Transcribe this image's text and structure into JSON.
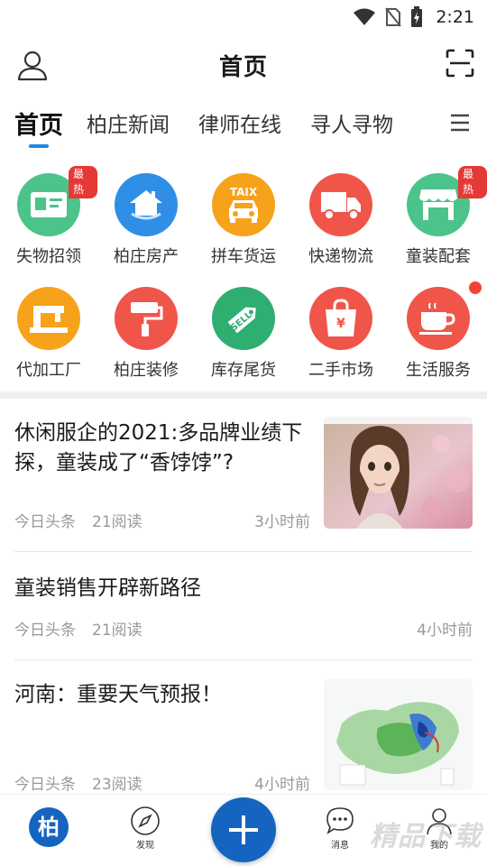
{
  "status": {
    "time": "2:21"
  },
  "header": {
    "title": "首页"
  },
  "tabs": [
    {
      "label": "首页",
      "active": true
    },
    {
      "label": "柏庄新闻"
    },
    {
      "label": "律师在线"
    },
    {
      "label": "寻人寻物"
    }
  ],
  "grid": [
    {
      "label": "失物招领",
      "icon": "id-card-icon",
      "color": "#4cc38a",
      "badge": "最热"
    },
    {
      "label": "柏庄房产",
      "icon": "house-icon",
      "color": "#2f8fe6"
    },
    {
      "label": "拼车货运",
      "icon": "taxi-icon",
      "color": "#f7a21b",
      "icon_text": "TAIX"
    },
    {
      "label": "快递物流",
      "icon": "truck-icon",
      "color": "#f0554a"
    },
    {
      "label": "童装配套",
      "icon": "shop-icon",
      "color": "#4cc38a",
      "badge": "最热"
    },
    {
      "label": "代加工厂",
      "icon": "sewing-machine-icon",
      "color": "#f7a21b"
    },
    {
      "label": "柏庄装修",
      "icon": "paint-roller-icon",
      "color": "#f0554a"
    },
    {
      "label": "库存尾货",
      "icon": "sell-tag-icon",
      "color": "#2fae72",
      "icon_text": "SELL"
    },
    {
      "label": "二手市场",
      "icon": "shopping-bag-icon",
      "color": "#f0554a",
      "icon_text": "¥"
    },
    {
      "label": "生活服务",
      "icon": "coffee-cup-icon",
      "color": "#f0554a",
      "dot": true
    }
  ],
  "news": [
    {
      "headline": "休闲服企的2021:多品牌业绩下探，童装成了“香饽饽”?",
      "source": "今日头条",
      "reads": "21阅读",
      "time": "3小时前",
      "thumb": "doll-photo"
    },
    {
      "headline": "童装销售开辟新路径",
      "source": "今日头条",
      "reads": "21阅读",
      "time": "4小时前"
    },
    {
      "headline": "河南：重要天气预报！",
      "source": "今日头条",
      "reads": "23阅读",
      "time": "4小时前",
      "thumb": "weather-map"
    }
  ],
  "bottom_nav": {
    "logo_text": "柏",
    "discover": "发现",
    "messages": "消息",
    "mine": "我的",
    "watermark": "精品下载"
  },
  "colors": {
    "accent": "#1e88e5",
    "fab": "#1565c0",
    "hot": "#e53935"
  }
}
